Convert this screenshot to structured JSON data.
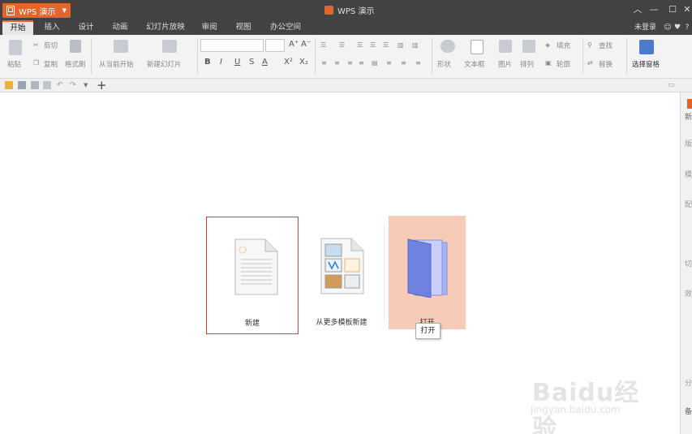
{
  "titlebar": {
    "app_button": "WPS 演示",
    "window_title": "WPS 演示"
  },
  "tabs": [
    "开始",
    "插入",
    "设计",
    "动画",
    "幻灯片放映",
    "审阅",
    "视图",
    "办公空间"
  ],
  "login": "未登录",
  "ribbon": {
    "paste": "粘贴",
    "cut": "剪切",
    "copy": "复制",
    "format_painter": "格式刷",
    "from_current": "从当前开始",
    "new_slide": "新建幻灯片",
    "shape": "形状",
    "textbox": "文本框",
    "picture": "图片",
    "arrange": "排列",
    "fill": "填充",
    "outline": "轮廓",
    "find": "查找",
    "replace": "替换",
    "selection_pane": "选择窗格",
    "bold": "B",
    "italic": "I",
    "underline": "U",
    "strike": "S",
    "font_color": "A",
    "superscript": "X²",
    "subscript": "X₂",
    "grow": "A⁺",
    "shrink": "A⁻"
  },
  "start": {
    "new": "新建",
    "from_template": "从更多模板新建",
    "open": "打开",
    "tooltip": "打开"
  },
  "right_panel": [
    "新",
    "版",
    "模",
    "配",
    "切",
    "效",
    "分",
    "备"
  ],
  "watermark": {
    "text": "Baidu经验",
    "url": "jingyan.baidu.com"
  }
}
